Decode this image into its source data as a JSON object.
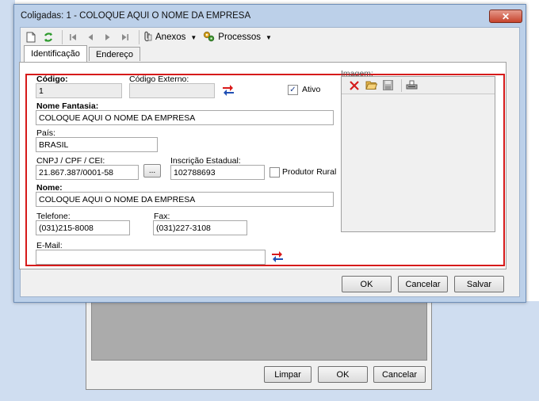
{
  "background_dialog": {
    "buttons": {
      "clear": "Limpar",
      "ok": "OK",
      "cancel": "Cancelar"
    }
  },
  "window": {
    "title": "Coligadas: 1 - COLOQUE AQUI O NOME DA EMPRESA",
    "close_glyph": "✕"
  },
  "toolbar": {
    "attachments_label": "Anexos",
    "processes_label": "Processos"
  },
  "tabs": [
    {
      "label": "Identificação",
      "active": true
    },
    {
      "label": "Endereço",
      "active": false
    }
  ],
  "form": {
    "codigo_label": "Código:",
    "codigo_value": "1",
    "codigo_externo_label": "Código Externo:",
    "codigo_externo_value": "",
    "ativo_label": "Ativo",
    "ativo_checked": true,
    "nome_fantasia_label": "Nome Fantasia:",
    "nome_fantasia_value": "COLOQUE AQUI O NOME DA EMPRESA",
    "pais_label": "País:",
    "pais_value": "BRASIL",
    "cnpj_label": "CNPJ / CPF / CEI:",
    "cnpj_value": "21.867.387/0001-58",
    "lookup_label": "...",
    "inscricao_label": "Inscrição Estadual:",
    "inscricao_value": "102788693",
    "produtor_rural_label": "Produtor Rural",
    "produtor_rural_checked": false,
    "nome_label": "Nome:",
    "nome_value": "COLOQUE AQUI O NOME DA EMPRESA",
    "telefone_label": "Telefone:",
    "telefone_value": "(031)215-8008",
    "fax_label": "Fax:",
    "fax_value": "(031)227-3108",
    "email_label": "E-Mail:",
    "email_value": ""
  },
  "image_panel": {
    "label": "Imagem:"
  },
  "footer_buttons": {
    "ok": "OK",
    "cancel": "Cancelar",
    "save": "Salvar"
  },
  "colors": {
    "highlight_border": "#d61a1a",
    "window_frame": "#bcd0e9",
    "swap_red": "#d91a1a",
    "swap_blue": "#1f4fb4"
  }
}
